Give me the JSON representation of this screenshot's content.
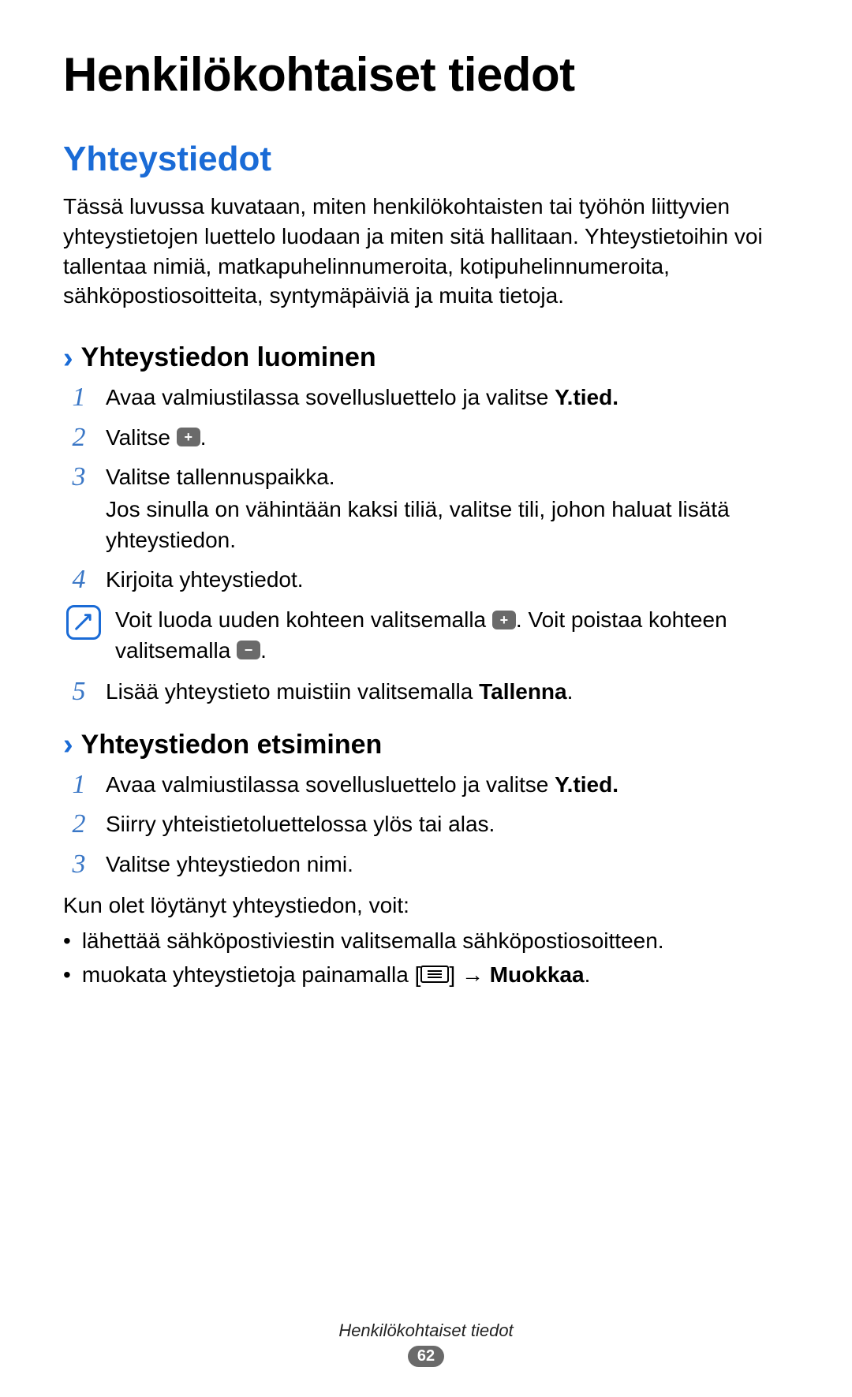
{
  "title": "Henkilökohtaiset tiedot",
  "section": {
    "heading": "Yhteystiedot",
    "intro": "Tässä luvussa kuvataan, miten henkilökohtaisten tai työhön liittyvien yhteystietojen luettelo luodaan ja miten sitä hallitaan. Yhteystietoihin voi tallentaa nimiä, matkapuhelinnumeroita, kotipuhelinnumeroita, sähköpostiosoitteita, syntymäpäiviä ja muita tietoja."
  },
  "sub1": {
    "heading": "Yhteystiedon luominen",
    "steps": {
      "1": {
        "pre": "Avaa valmiustilassa sovellusluettelo ja valitse ",
        "bold": "Y.tied."
      },
      "2": {
        "pre": "Valitse ",
        "icon": "plus-icon",
        "post": "."
      },
      "3": {
        "line1": "Valitse tallennuspaikka.",
        "line2": "Jos sinulla on vähintään kaksi tiliä, valitse tili, johon haluat lisätä yhteystiedon."
      },
      "4": {
        "text": "Kirjoita yhteystiedot."
      },
      "note": {
        "pre": "Voit luoda uuden kohteen valitsemalla ",
        "icon1": "plus-icon",
        "mid": ". Voit poistaa kohteen valitsemalla ",
        "icon2": "minus-icon",
        "post": "."
      },
      "5": {
        "pre": "Lisää yhteystieto muistiin valitsemalla ",
        "bold": "Tallenna",
        "post": "."
      }
    }
  },
  "sub2": {
    "heading": "Yhteystiedon etsiminen",
    "steps": {
      "1": {
        "pre": "Avaa valmiustilassa sovellusluettelo ja valitse ",
        "bold": "Y.tied."
      },
      "2": {
        "text": "Siirry yhteistietoluettelossa ylös tai alas."
      },
      "3": {
        "text": "Valitse yhteystiedon nimi."
      }
    },
    "after": "Kun olet löytänyt yhteystiedon, voit:",
    "bullets": {
      "0": {
        "text": "lähettää sähköpostiviestin valitsemalla sähköpostiosoitteen."
      },
      "1": {
        "pre": "muokata yhteystietoja painamalla [",
        "icon": "menu-icon",
        "mid": "] → ",
        "bold": "Muokkaa",
        "post": "."
      }
    }
  },
  "nums": {
    "1": "1",
    "2": "2",
    "3": "3",
    "4": "4",
    "5": "5"
  },
  "chevron": "›",
  "icons": {
    "plus": "+",
    "minus": "−"
  },
  "footer": {
    "title": "Henkilökohtaiset tiedot",
    "page": "62"
  }
}
